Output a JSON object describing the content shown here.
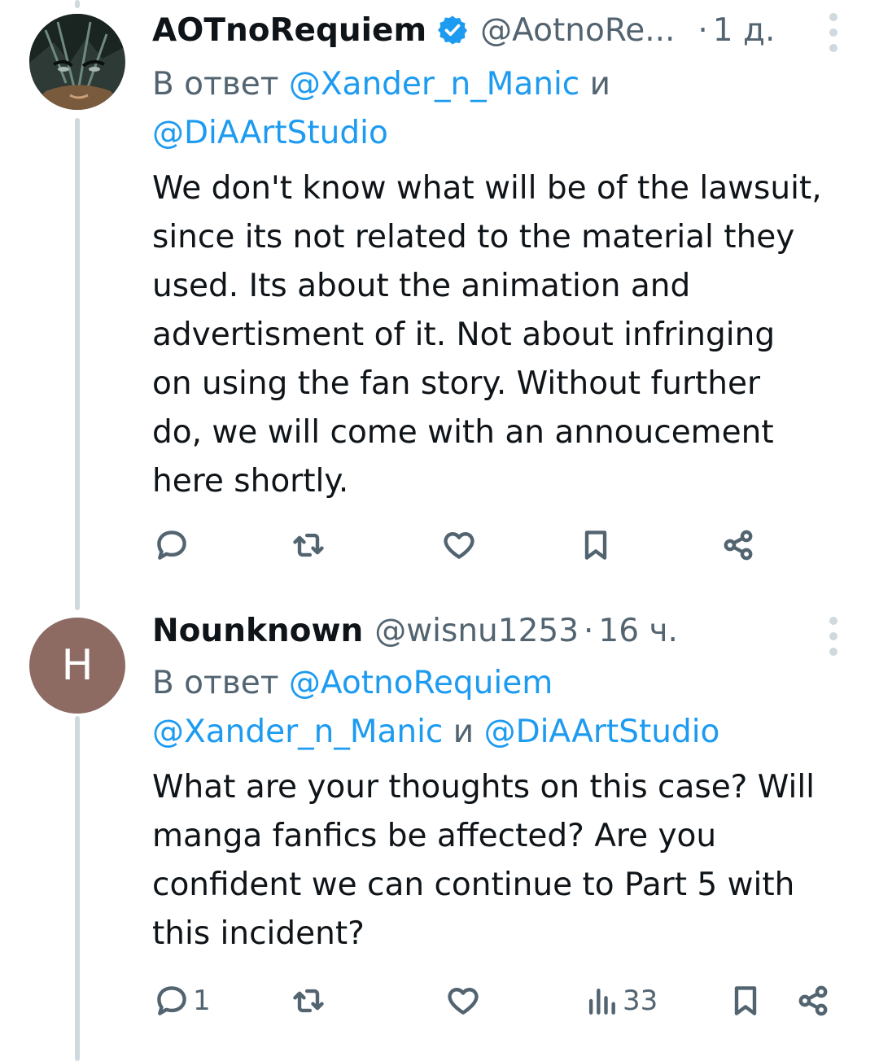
{
  "tweets": [
    {
      "name": "AOTnoRequiem",
      "handle": "@AotnoRe...",
      "dot": "·",
      "time": "1 д.",
      "reply_prefix": "В ответ",
      "reply_mention_1": "@Xander_n_Manic",
      "reply_joiner": "и",
      "reply_mention_2": "@DiAArtStudio",
      "text": "We don't know what will be of the lawsuit,\nsince its not related to the material they\nused. Its about the animation and\nadvertisment of it. Not about infringing\non using the fan story. Without further\ndo, we will come with an annoucement\nhere shortly.",
      "avatar_icon": "anime-character-avatar",
      "verified_icon": "verified-badge-icon",
      "verified_color": "#1d9bf0"
    },
    {
      "name": "Nounknown",
      "handle": "@wisnu1253",
      "dot": "·",
      "time": "16 ч.",
      "reply_prefix": "В ответ",
      "reply_mention_1": "@AotnoRequiem",
      "reply_mention_2": "@Xander_n_Manic",
      "reply_joiner": "и",
      "reply_mention_3": "@DiAArtStudio",
      "text": "What are your thoughts on this case? Will\nmanga fanfics be affected? Are you\nconfident we can continue to Part 5 with\nthis incident?",
      "avatar_letter": "H",
      "avatar_color": "#8d6b62",
      "reply_count": "1",
      "views_count": "33"
    }
  ],
  "colors": {
    "accent": "#1d9bf0",
    "secondary_text": "#536471",
    "thread_line": "#cfd9de"
  }
}
